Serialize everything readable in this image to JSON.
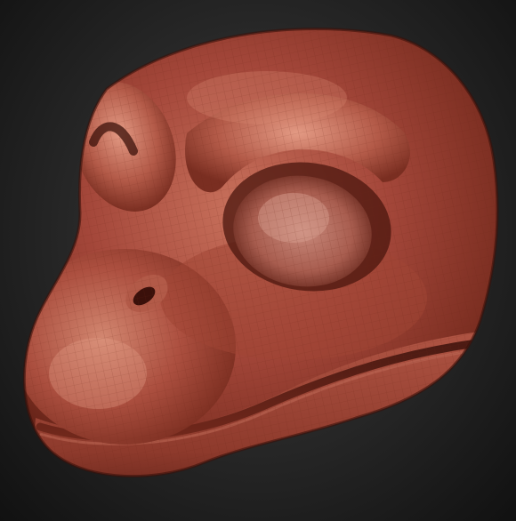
{
  "scene": {
    "subject_icon": "sculpted-creature-head-icon",
    "colors": {
      "background_center": "#3b3b3b",
      "background_edge": "#111111",
      "clay_base": "#9c3f2e",
      "clay_light": "#c8715c",
      "clay_highlight": "#e39a84",
      "clay_shadow": "#5a1d13",
      "clay_deep_shadow": "#3a100a",
      "wireframe": "#7a2e21"
    }
  }
}
